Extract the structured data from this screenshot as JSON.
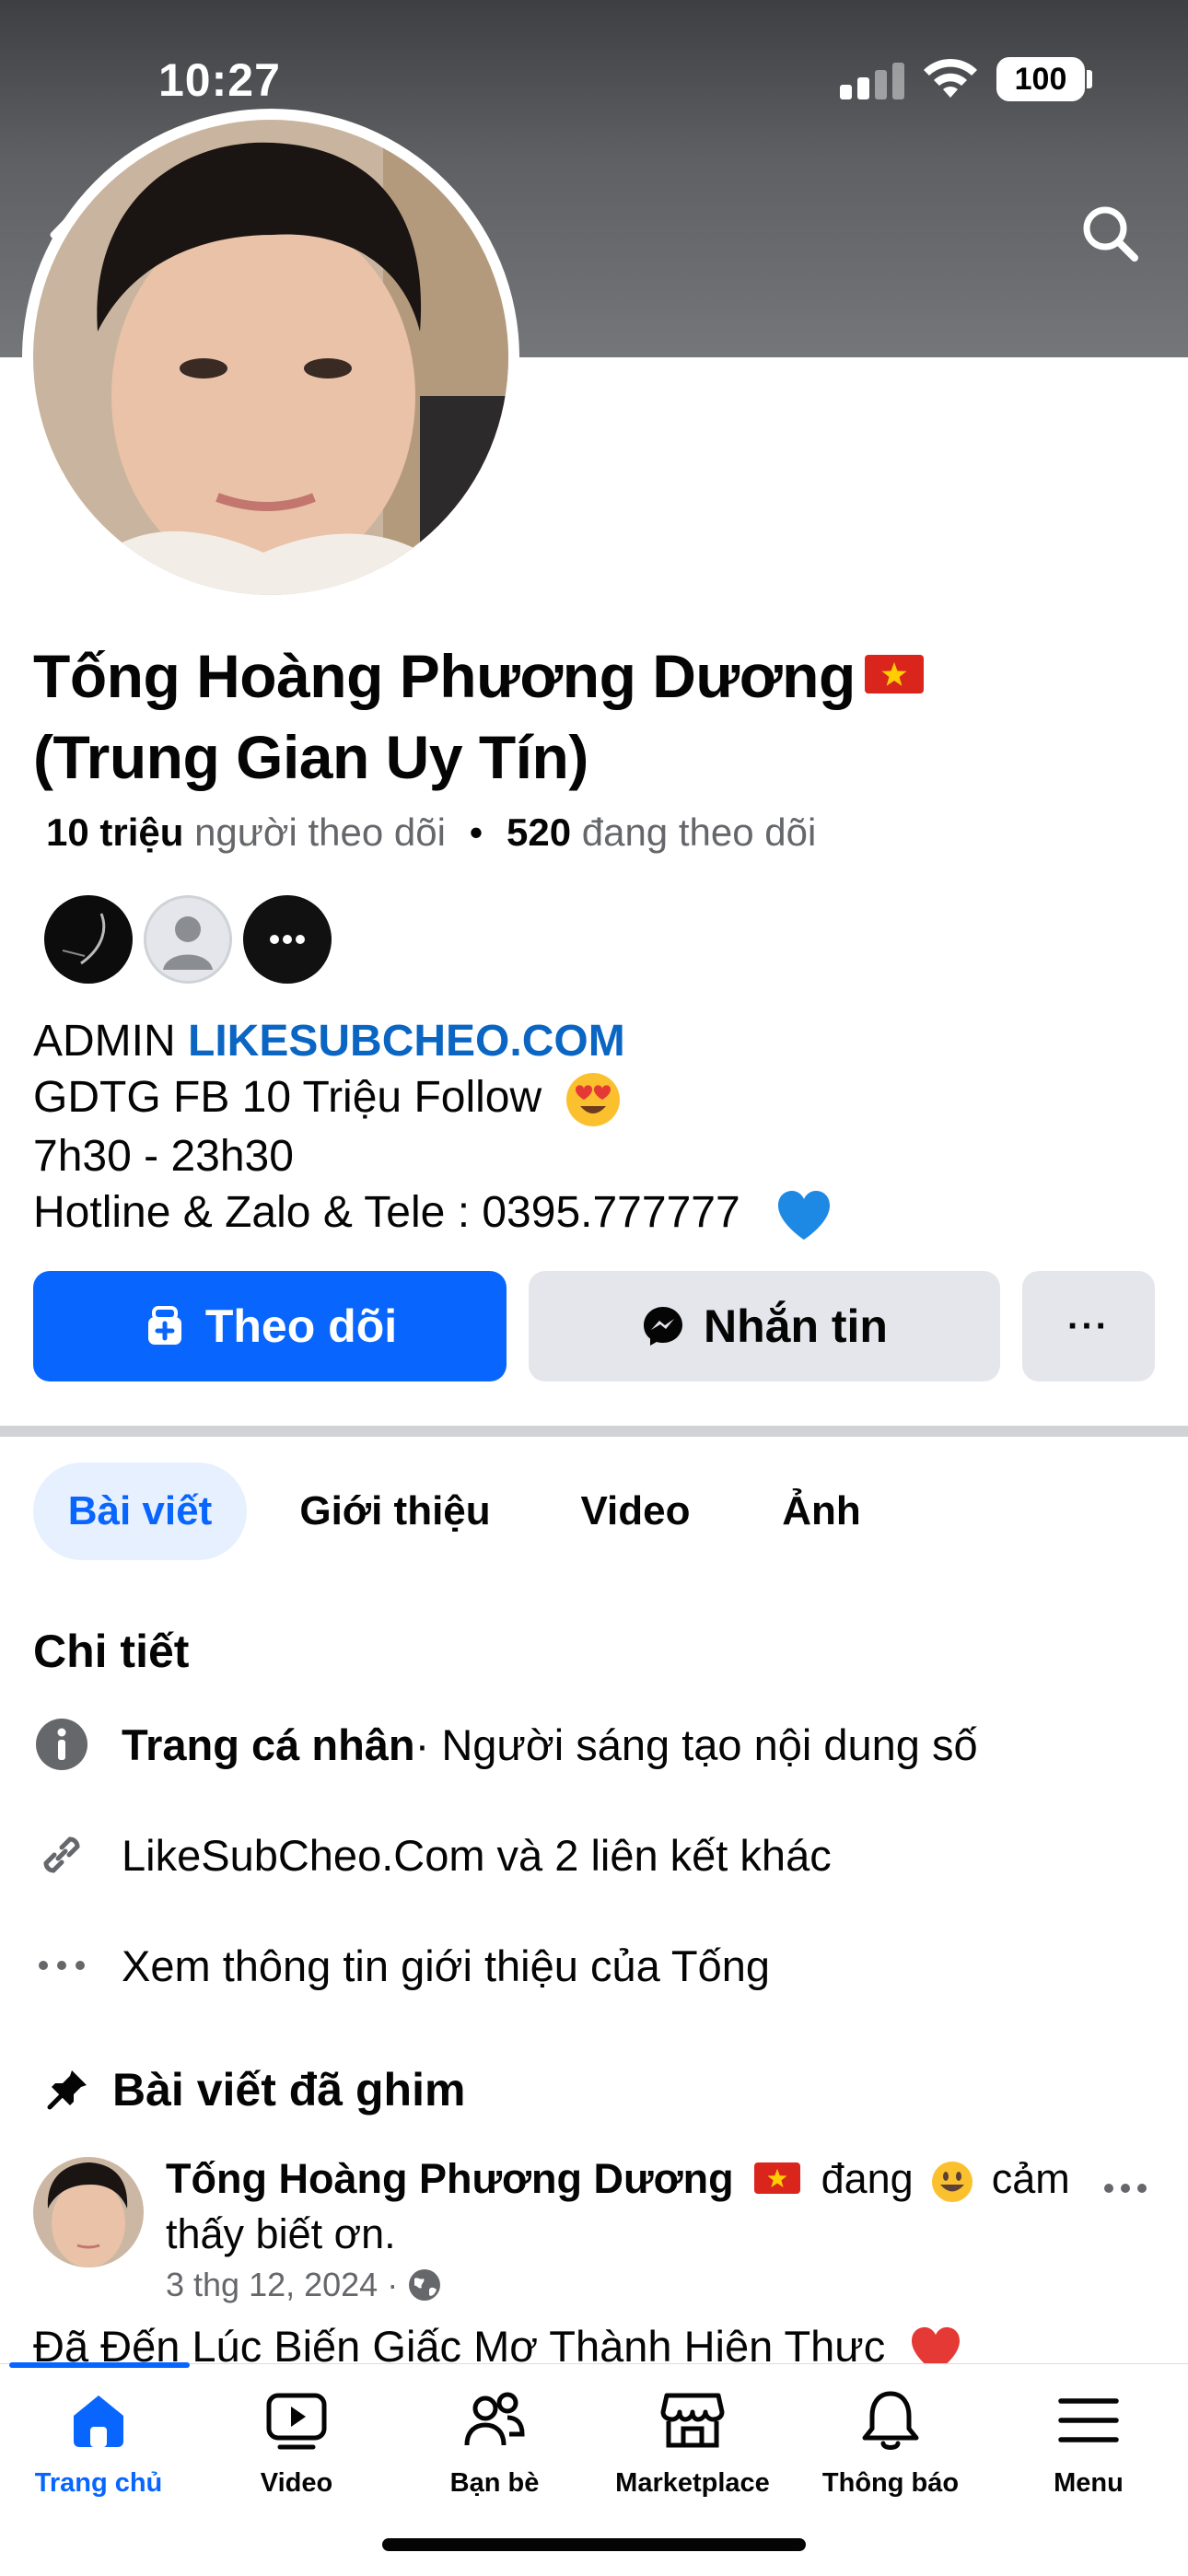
{
  "status_bar": {
    "time": "10:27",
    "battery": "100"
  },
  "profile": {
    "name_line1": "Tống Hoàng Phương Dương",
    "name_line2": "(Trung Gian Uy Tín)",
    "followers_count": "10 triệu",
    "followers_label": "người theo dõi",
    "separator": "•",
    "following_count": "520",
    "following_label": "đang theo dõi",
    "bio": {
      "line1_prefix": "ADMIN",
      "line1_link": "LIKESUBCHEO.COM",
      "line2": "GDTG FB 10 Triệu Follow",
      "line3": "7h30 - 23h30",
      "line4": "Hotline & Zalo & Tele : 0395.777777"
    }
  },
  "actions": {
    "follow_label": "Theo dõi",
    "message_label": "Nhắn tin",
    "more_label": "···"
  },
  "tabs": [
    {
      "label": "Bài viết",
      "active": true
    },
    {
      "label": "Giới thiệu",
      "active": false
    },
    {
      "label": "Video",
      "active": false
    },
    {
      "label": "Ảnh",
      "active": false
    }
  ],
  "details": {
    "heading": "Chi tiết",
    "page_type_bold": "Trang cá nhân",
    "page_type_rest": " · Người sáng tạo nội dung số",
    "links": "LikeSubCheo.Com và 2 liên kết khác",
    "see_more": "Xem thông tin giới thiệu của Tống"
  },
  "pinned": {
    "heading": "Bài viết đã ghim",
    "post": {
      "author": "Tống Hoàng Phương Dương",
      "status_prefix": "đang",
      "status_suffix": "cảm thấy biết ơn.",
      "date": "3 thg 12, 2024",
      "meta_separator": "·",
      "text": "Đã Đến Lúc Biến Giấc Mơ Thành Hiện Thực"
    }
  },
  "bottom_nav": [
    {
      "label": "Trang chủ",
      "icon": "home-icon",
      "active": true
    },
    {
      "label": "Video",
      "icon": "video-icon",
      "active": false
    },
    {
      "label": "Bạn bè",
      "icon": "friends-icon",
      "active": false
    },
    {
      "label": "Marketplace",
      "icon": "marketplace-icon",
      "active": false
    },
    {
      "label": "Thông báo",
      "icon": "bell-icon",
      "active": false
    },
    {
      "label": "Menu",
      "icon": "menu-icon",
      "active": false
    }
  ],
  "colors": {
    "accent": "#0866ff",
    "link": "#0a66c2",
    "secondary_text": "#65676b",
    "button_gray": "#e4e6eb"
  }
}
